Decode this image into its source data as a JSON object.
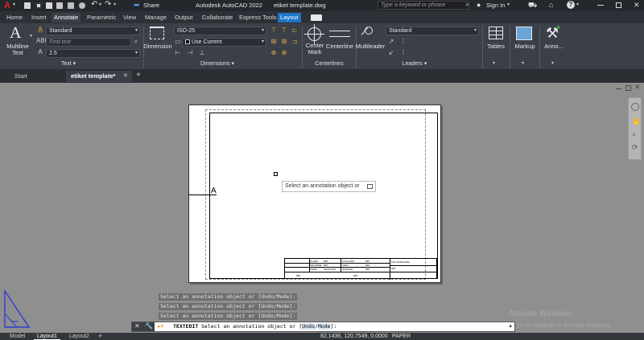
{
  "titlebar": {
    "app_title": "Autodesk AutoCAD 2022",
    "file_name": "etiket template.dwg",
    "share_label": "Share",
    "search_placeholder": "Type a keyword or phrase",
    "signin_label": "Sign In"
  },
  "ribbon_tabs": [
    "Home",
    "Insert",
    "Annotate",
    "Parametric",
    "View",
    "Manage",
    "Output",
    "Collaborate",
    "Express Tools",
    "Layout"
  ],
  "ribbon": {
    "text_panel": {
      "big_button": "Multiline\nText",
      "style_value": "Standard",
      "find_placeholder": "Find text",
      "height_value": "2.5",
      "label": "Text"
    },
    "dimensions_panel": {
      "big_button": "Dimension",
      "style_value": "ISO-25",
      "layer_value": "Use Current",
      "label": "Dimensions"
    },
    "centerlines_panel": {
      "center_mark": "Center\nMark",
      "centerline": "Centerline",
      "label": "Centerlines"
    },
    "leaders_panel": {
      "big_button": "Multileader",
      "style_value": "Standard",
      "label": "Leaders"
    },
    "tables_button": "Tables",
    "markup_button": "Markup",
    "annotation_button": "Anno..."
  },
  "doc_tabs": {
    "start": "Start",
    "active": "etiket template*"
  },
  "canvas": {
    "text_edit_prompt": "Select an annotation object or",
    "mtext_letter": "A",
    "title_block": {
      "r1": [
        "OLCEK",
        "###",
        "ACIKLAMA",
        "###"
      ],
      "r2": [
        "MALZEME",
        "###",
        "ADET",
        "###"
      ],
      "r3": [
        "TARIH",
        "01/01/2023",
        "ISTENEN",
        "###"
      ],
      "right_header": "KIS TANIMLAMA",
      "right_value": "###",
      "bottom_left": "###",
      "bottom_mid": "###"
    }
  },
  "command_history": [
    "Select an annotation object or [Undo/Mode]:",
    "Select an annotation object or [Undo/Mode]:",
    "Select an annotation object or [Undo/Mode]:"
  ],
  "command_line": {
    "command": "TEXTEDIT",
    "prompt": "Select an annotation object or [",
    "opt1": "Undo",
    "opt2": "Mode",
    "tail": "]:"
  },
  "watermark": {
    "line1": "Activate Windows",
    "line2": "Go to Settings to activate Windows."
  },
  "status_bar": {
    "tabs": [
      "Model",
      "Layout1",
      "Layout2"
    ],
    "coords": "82.1436, 120.7549, 0.0000",
    "space": "PAPER"
  }
}
